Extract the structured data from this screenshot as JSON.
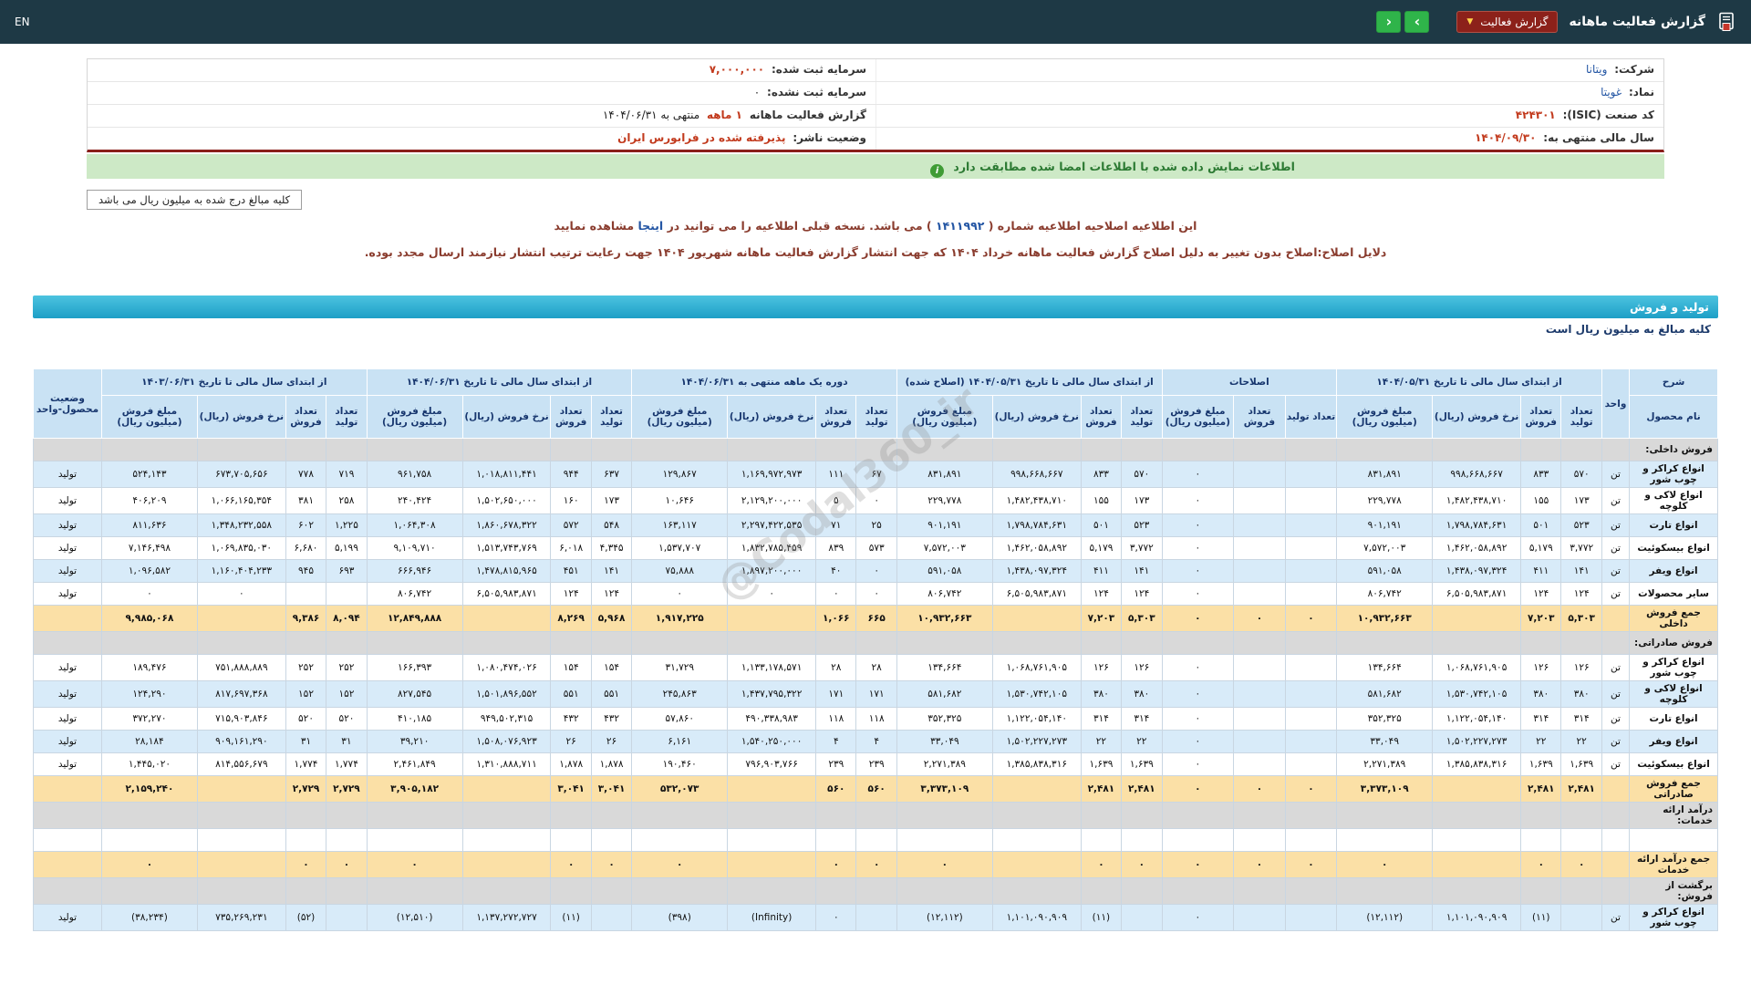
{
  "top_bar": {
    "title": "گزارش فعالیت ماهانه",
    "report_dropdown_label": "گزارش فعالیت",
    "nav_next": "›",
    "nav_prev": "‹",
    "lang": "EN"
  },
  "company_info": {
    "rows": [
      {
        "r_label": "شرکت:",
        "r_value": "ویتانا",
        "l_label": "سرمایه ثبت شده:",
        "l_value": "۷,۰۰۰,۰۰۰"
      },
      {
        "r_label": "نماد:",
        "r_value": "غویتا",
        "l_label": "سرمایه ثبت نشده:",
        "l_value": "۰"
      },
      {
        "r_label": "کد صنعت (ISIC):",
        "r_value": "۴۲۴۳۰۱",
        "l_label": "گزارش فعالیت ماهانه",
        "l_value": "۱ ماهه",
        "l_suffix": "منتهی به ۱۴۰۴/۰۶/۳۱"
      },
      {
        "r_label": "سال مالی منتهی به:",
        "r_value": "۱۴۰۴/۰۹/۳۰",
        "l_label": "وضعیت ناشر:",
        "l_value": "پذیرفته شده در فرابورس ایران"
      }
    ]
  },
  "banner": {
    "text": "اطلاعات نمایش داده شده با اطلاعات امضا شده مطابقت دارد"
  },
  "amounts_note": "کلیه مبالغ درج شده به میلیون ریال می باشد",
  "amendment": {
    "l1a": "این اطلاعیه اصلاحیه اطلاعیه شماره ( ",
    "l1_num": "۱۴۱۱۹۹۲",
    "l1b": " ) می باشد. نسخه قبلی اطلاعیه را می توانید در ",
    "l1_link": "اینجا",
    "l1c": " مشاهده نمایید",
    "line2": "دلایل اصلاح:اصلاح بدون تغییر به دلیل اصلاح گزارش فعالیت ماهانه خرداد ۱۴۰۴ که جهت انتشار گزارش فعالیت ماهانه شهریور ۱۴۰۴ جهت رعایت ترتیب انتشار نیازمند ارسال مجدد بوده."
  },
  "section_bar": "تولید و فروش",
  "table_note": "کلیه مبالغ به میلیون ریال است",
  "watermark": "@Codal360_ir",
  "table": {
    "columns": {
      "desc": "شرح",
      "desc_sub": "نام محصول",
      "unit": "واحد",
      "status": "وضعیت محصول-واحد"
    },
    "groups": [
      {
        "id": "g05",
        "title": "از ابتدای سال مالی تا تاریخ ۱۴۰۴/۰۵/۳۱",
        "cols": [
          "تعداد تولید",
          "تعداد فروش",
          "نرخ فروش (ریال)",
          "مبلغ فروش (میلیون ریال)"
        ]
      },
      {
        "id": "adj",
        "title": "اصلاحات",
        "cols": [
          "تعداد تولید",
          "تعداد فروش",
          "مبلغ فروش (میلیون ریال)"
        ]
      },
      {
        "id": "g05r",
        "title": "از ابتدای سال مالی تا تاریخ ۱۴۰۴/۰۵/۳۱ (اصلاح شده)",
        "cols": [
          "تعداد تولید",
          "تعداد فروش",
          "نرخ فروش (ریال)",
          "مبلغ فروش (میلیون ریال)"
        ]
      },
      {
        "id": "month",
        "title": "دوره یک ماهه منتهی به ۱۴۰۴/۰۶/۳۱",
        "cols": [
          "تعداد تولید",
          "تعداد فروش",
          "نرخ فروش (ریال)",
          "مبلغ فروش (میلیون ریال)"
        ]
      },
      {
        "id": "g06",
        "title": "از ابتدای سال مالی تا تاریخ ۱۴۰۴/۰۶/۳۱",
        "cols": [
          "تعداد تولید",
          "تعداد فروش",
          "نرخ فروش (ریال)",
          "مبلغ فروش (میلیون ریال)"
        ]
      },
      {
        "id": "g03",
        "title": "از ابتدای سال مالی تا تاریخ ۱۴۰۳/۰۶/۳۱",
        "cols": [
          "تعداد تولید",
          "تعداد فروش",
          "نرخ فروش (ریال)",
          "مبلغ فروش (میلیون ریال)"
        ]
      }
    ],
    "rows": [
      {
        "type": "section",
        "label": "فروش داخلی:"
      },
      {
        "type": "data",
        "shade": "blue",
        "name": "انواع کراکر و چوب شور",
        "unit": "تن",
        "status": "تولید",
        "g05": [
          "۵۷۰",
          "۸۳۳",
          "۹۹۸,۶۶۸,۶۶۷",
          "۸۳۱,۸۹۱"
        ],
        "adj": [
          "",
          "",
          "۰"
        ],
        "g05r": [
          "۵۷۰",
          "۸۳۳",
          "۹۹۸,۶۶۸,۶۶۷",
          "۸۳۱,۸۹۱"
        ],
        "month": [
          "۶۷",
          "۱۱۱",
          "۱,۱۶۹,۹۷۲,۹۷۳",
          "۱۲۹,۸۶۷"
        ],
        "g06": [
          "۶۳۷",
          "۹۴۴",
          "۱,۰۱۸,۸۱۱,۴۴۱",
          "۹۶۱,۷۵۸"
        ],
        "g03": [
          "۷۱۹",
          "۷۷۸",
          "۶۷۳,۷۰۵,۶۵۶",
          "۵۲۴,۱۴۳"
        ]
      },
      {
        "type": "data",
        "shade": "white",
        "name": "انواع لاکی و کلوچه",
        "unit": "تن",
        "status": "تولید",
        "g05": [
          "۱۷۳",
          "۱۵۵",
          "۱,۴۸۲,۴۳۸,۷۱۰",
          "۲۲۹,۷۷۸"
        ],
        "adj": [
          "",
          "",
          "۰"
        ],
        "g05r": [
          "۱۷۳",
          "۱۵۵",
          "۱,۴۸۲,۴۳۸,۷۱۰",
          "۲۲۹,۷۷۸"
        ],
        "month": [
          "۰",
          "۵",
          "۲,۱۲۹,۲۰۰,۰۰۰",
          "۱۰,۶۴۶"
        ],
        "g06": [
          "۱۷۳",
          "۱۶۰",
          "۱,۵۰۲,۶۵۰,۰۰۰",
          "۲۴۰,۴۲۴"
        ],
        "g03": [
          "۲۵۸",
          "۳۸۱",
          "۱,۰۶۶,۱۶۵,۳۵۴",
          "۴۰۶,۲۰۹"
        ]
      },
      {
        "type": "data",
        "shade": "blue",
        "name": "انواع تارت",
        "unit": "تن",
        "status": "تولید",
        "g05": [
          "۵۲۳",
          "۵۰۱",
          "۱,۷۹۸,۷۸۴,۶۳۱",
          "۹۰۱,۱۹۱"
        ],
        "adj": [
          "",
          "",
          "۰"
        ],
        "g05r": [
          "۵۲۳",
          "۵۰۱",
          "۱,۷۹۸,۷۸۴,۶۳۱",
          "۹۰۱,۱۹۱"
        ],
        "month": [
          "۲۵",
          "۷۱",
          "۲,۲۹۷,۴۲۲,۵۳۵",
          "۱۶۳,۱۱۷"
        ],
        "g06": [
          "۵۴۸",
          "۵۷۲",
          "۱,۸۶۰,۶۷۸,۳۲۲",
          "۱,۰۶۴,۳۰۸"
        ],
        "g03": [
          "۱,۲۲۵",
          "۶۰۲",
          "۱,۳۴۸,۲۳۲,۵۵۸",
          "۸۱۱,۶۳۶"
        ]
      },
      {
        "type": "data",
        "shade": "white",
        "name": "انواع بیسکوئیت",
        "unit": "تن",
        "status": "تولید",
        "g05": [
          "۳,۷۷۲",
          "۵,۱۷۹",
          "۱,۴۶۲,۰۵۸,۸۹۲",
          "۷,۵۷۲,۰۰۳"
        ],
        "adj": [
          "",
          "",
          "۰"
        ],
        "g05r": [
          "۳,۷۷۲",
          "۵,۱۷۹",
          "۱,۴۶۲,۰۵۸,۸۹۲",
          "۷,۵۷۲,۰۰۳"
        ],
        "month": [
          "۵۷۳",
          "۸۳۹",
          "۱,۸۳۲,۷۸۵,۴۵۹",
          "۱,۵۳۷,۷۰۷"
        ],
        "g06": [
          "۴,۳۴۵",
          "۶,۰۱۸",
          "۱,۵۱۳,۷۴۳,۷۶۹",
          "۹,۱۰۹,۷۱۰"
        ],
        "g03": [
          "۵,۱۹۹",
          "۶,۶۸۰",
          "۱,۰۶۹,۸۳۵,۰۳۰",
          "۷,۱۴۶,۴۹۸"
        ]
      },
      {
        "type": "data",
        "shade": "blue",
        "name": "انواع ویفر",
        "unit": "تن",
        "status": "تولید",
        "g05": [
          "۱۴۱",
          "۴۱۱",
          "۱,۴۳۸,۰۹۷,۳۲۴",
          "۵۹۱,۰۵۸"
        ],
        "adj": [
          "",
          "",
          "۰"
        ],
        "g05r": [
          "۱۴۱",
          "۴۱۱",
          "۱,۴۳۸,۰۹۷,۳۲۴",
          "۵۹۱,۰۵۸"
        ],
        "month": [
          "۰",
          "۴۰",
          "۱,۸۹۷,۲۰۰,۰۰۰",
          "۷۵,۸۸۸"
        ],
        "g06": [
          "۱۴۱",
          "۴۵۱",
          "۱,۴۷۸,۸۱۵,۹۶۵",
          "۶۶۶,۹۴۶"
        ],
        "g03": [
          "۶۹۳",
          "۹۴۵",
          "۱,۱۶۰,۴۰۴,۲۳۳",
          "۱,۰۹۶,۵۸۲"
        ]
      },
      {
        "type": "data",
        "shade": "white",
        "name": "سایر محصولات",
        "unit": "تن",
        "status": "تولید",
        "g05": [
          "۱۲۴",
          "۱۲۴",
          "۶,۵۰۵,۹۸۳,۸۷۱",
          "۸۰۶,۷۴۲"
        ],
        "adj": [
          "",
          "",
          "۰"
        ],
        "g05r": [
          "۱۲۴",
          "۱۲۴",
          "۶,۵۰۵,۹۸۳,۸۷۱",
          "۸۰۶,۷۴۲"
        ],
        "month": [
          "۰",
          "۰",
          "۰",
          "۰"
        ],
        "g06": [
          "۱۲۴",
          "۱۲۴",
          "۶,۵۰۵,۹۸۳,۸۷۱",
          "۸۰۶,۷۴۲"
        ],
        "g03": [
          "",
          "",
          "۰",
          "۰"
        ]
      },
      {
        "type": "total",
        "name": "جمع فروش داخلی",
        "g05": [
          "۵,۳۰۳",
          "۷,۲۰۳",
          "",
          "۱۰,۹۳۲,۶۶۳"
        ],
        "adj": [
          "۰",
          "۰",
          "۰"
        ],
        "g05r": [
          "۵,۳۰۳",
          "۷,۲۰۳",
          "",
          "۱۰,۹۳۲,۶۶۳"
        ],
        "month": [
          "۶۶۵",
          "۱,۰۶۶",
          "",
          "۱,۹۱۷,۲۲۵"
        ],
        "g06": [
          "۵,۹۶۸",
          "۸,۲۶۹",
          "",
          "۱۲,۸۴۹,۸۸۸"
        ],
        "g03": [
          "۸,۰۹۴",
          "۹,۳۸۶",
          "",
          "۹,۹۸۵,۰۶۸"
        ]
      },
      {
        "type": "section",
        "label": "فروش صادراتی:"
      },
      {
        "type": "data",
        "shade": "white",
        "name": "انواع کراکر و چوب شور",
        "unit": "تن",
        "status": "تولید",
        "g05": [
          "۱۲۶",
          "۱۲۶",
          "۱,۰۶۸,۷۶۱,۹۰۵",
          "۱۳۴,۶۶۴"
        ],
        "adj": [
          "",
          "",
          "۰"
        ],
        "g05r": [
          "۱۲۶",
          "۱۲۶",
          "۱,۰۶۸,۷۶۱,۹۰۵",
          "۱۳۴,۶۶۴"
        ],
        "month": [
          "۲۸",
          "۲۸",
          "۱,۱۳۳,۱۷۸,۵۷۱",
          "۳۱,۷۲۹"
        ],
        "g06": [
          "۱۵۴",
          "۱۵۴",
          "۱,۰۸۰,۴۷۴,۰۲۶",
          "۱۶۶,۳۹۳"
        ],
        "g03": [
          "۲۵۲",
          "۲۵۲",
          "۷۵۱,۸۸۸,۸۸۹",
          "۱۸۹,۴۷۶"
        ]
      },
      {
        "type": "data",
        "shade": "blue",
        "name": "انواع لاکی و کلوچه",
        "unit": "تن",
        "status": "تولید",
        "g05": [
          "۳۸۰",
          "۳۸۰",
          "۱,۵۳۰,۷۴۲,۱۰۵",
          "۵۸۱,۶۸۲"
        ],
        "adj": [
          "",
          "",
          "۰"
        ],
        "g05r": [
          "۳۸۰",
          "۳۸۰",
          "۱,۵۳۰,۷۴۲,۱۰۵",
          "۵۸۱,۶۸۲"
        ],
        "month": [
          "۱۷۱",
          "۱۷۱",
          "۱,۴۳۷,۷۹۵,۳۲۲",
          "۲۴۵,۸۶۳"
        ],
        "g06": [
          "۵۵۱",
          "۵۵۱",
          "۱,۵۰۱,۸۹۶,۵۵۲",
          "۸۲۷,۵۴۵"
        ],
        "g03": [
          "۱۵۲",
          "۱۵۲",
          "۸۱۷,۶۹۷,۳۶۸",
          "۱۲۴,۲۹۰"
        ]
      },
      {
        "type": "data",
        "shade": "white",
        "name": "انواع تارت",
        "unit": "تن",
        "status": "تولید",
        "g05": [
          "۳۱۴",
          "۳۱۴",
          "۱,۱۲۲,۰۵۴,۱۴۰",
          "۳۵۲,۳۲۵"
        ],
        "adj": [
          "",
          "",
          "۰"
        ],
        "g05r": [
          "۳۱۴",
          "۳۱۴",
          "۱,۱۲۲,۰۵۴,۱۴۰",
          "۳۵۲,۳۲۵"
        ],
        "month": [
          "۱۱۸",
          "۱۱۸",
          "۴۹۰,۳۳۸,۹۸۳",
          "۵۷,۸۶۰"
        ],
        "g06": [
          "۴۳۲",
          "۴۳۲",
          "۹۴۹,۵۰۲,۳۱۵",
          "۴۱۰,۱۸۵"
        ],
        "g03": [
          "۵۲۰",
          "۵۲۰",
          "۷۱۵,۹۰۳,۸۴۶",
          "۳۷۲,۲۷۰"
        ]
      },
      {
        "type": "data",
        "shade": "blue",
        "name": "انواع ویفر",
        "unit": "تن",
        "status": "تولید",
        "g05": [
          "۲۲",
          "۲۲",
          "۱,۵۰۲,۲۲۷,۲۷۳",
          "۳۳,۰۴۹"
        ],
        "adj": [
          "",
          "",
          "۰"
        ],
        "g05r": [
          "۲۲",
          "۲۲",
          "۱,۵۰۲,۲۲۷,۲۷۳",
          "۳۳,۰۴۹"
        ],
        "month": [
          "۴",
          "۴",
          "۱,۵۴۰,۲۵۰,۰۰۰",
          "۶,۱۶۱"
        ],
        "g06": [
          "۲۶",
          "۲۶",
          "۱,۵۰۸,۰۷۶,۹۲۳",
          "۳۹,۲۱۰"
        ],
        "g03": [
          "۳۱",
          "۳۱",
          "۹۰۹,۱۶۱,۲۹۰",
          "۲۸,۱۸۴"
        ]
      },
      {
        "type": "data",
        "shade": "white",
        "name": "انواع بیسکوئیت",
        "unit": "تن",
        "status": "تولید",
        "g05": [
          "۱,۶۳۹",
          "۱,۶۳۹",
          "۱,۳۸۵,۸۳۸,۳۱۶",
          "۲,۲۷۱,۳۸۹"
        ],
        "adj": [
          "",
          "",
          "۰"
        ],
        "g05r": [
          "۱,۶۳۹",
          "۱,۶۳۹",
          "۱,۳۸۵,۸۳۸,۳۱۶",
          "۲,۲۷۱,۳۸۹"
        ],
        "month": [
          "۲۳۹",
          "۲۳۹",
          "۷۹۶,۹۰۳,۷۶۶",
          "۱۹۰,۴۶۰"
        ],
        "g06": [
          "۱,۸۷۸",
          "۱,۸۷۸",
          "۱,۳۱۰,۸۸۸,۷۱۱",
          "۲,۴۶۱,۸۴۹"
        ],
        "g03": [
          "۱,۷۷۴",
          "۱,۷۷۴",
          "۸۱۴,۵۵۶,۶۷۹",
          "۱,۴۴۵,۰۲۰"
        ]
      },
      {
        "type": "total",
        "name": "جمع فروش صادراتی",
        "g05": [
          "۲,۴۸۱",
          "۲,۴۸۱",
          "",
          "۳,۳۷۳,۱۰۹"
        ],
        "adj": [
          "۰",
          "۰",
          "۰"
        ],
        "g05r": [
          "۲,۴۸۱",
          "۲,۴۸۱",
          "",
          "۳,۳۷۳,۱۰۹"
        ],
        "month": [
          "۵۶۰",
          "۵۶۰",
          "",
          "۵۳۲,۰۷۳"
        ],
        "g06": [
          "۳,۰۴۱",
          "۳,۰۴۱",
          "",
          "۳,۹۰۵,۱۸۲"
        ],
        "g03": [
          "۲,۷۲۹",
          "۲,۷۲۹",
          "",
          "۲,۱۵۹,۲۴۰"
        ]
      },
      {
        "type": "section",
        "label": "درآمد ارائه خدمات:"
      },
      {
        "type": "empty"
      },
      {
        "type": "total",
        "name": "جمع درآمد ارائه خدمات",
        "g05": [
          "۰",
          "۰",
          "",
          "۰"
        ],
        "adj": [
          "۰",
          "۰",
          "۰"
        ],
        "g05r": [
          "۰",
          "۰",
          "",
          "۰"
        ],
        "month": [
          "۰",
          "۰",
          "",
          "۰"
        ],
        "g06": [
          "۰",
          "۰",
          "",
          "۰"
        ],
        "g03": [
          "۰",
          "۰",
          "",
          "۰"
        ]
      },
      {
        "type": "section",
        "label": "برگشت از فروش:"
      },
      {
        "type": "data",
        "shade": "blue",
        "name": "انواع کراکر و چوب شور",
        "unit": "تن",
        "status": "تولید",
        "g05": [
          "",
          "(۱۱)",
          "۱,۱۰۱,۰۹۰,۹۰۹",
          "(۱۲,۱۱۲)"
        ],
        "adj": [
          "",
          "",
          "۰"
        ],
        "g05r": [
          "",
          "(۱۱)",
          "۱,۱۰۱,۰۹۰,۹۰۹",
          "(۱۲,۱۱۲)"
        ],
        "month": [
          "",
          "۰",
          "(Infinity)",
          "(۳۹۸)"
        ],
        "g06": [
          "",
          "(۱۱)",
          "۱,۱۳۷,۲۷۲,۷۲۷",
          "(۱۲,۵۱۰)"
        ],
        "g03": [
          "",
          "(۵۲)",
          "۷۳۵,۲۶۹,۲۳۱",
          "(۳۸,۲۳۴)"
        ]
      }
    ]
  }
}
